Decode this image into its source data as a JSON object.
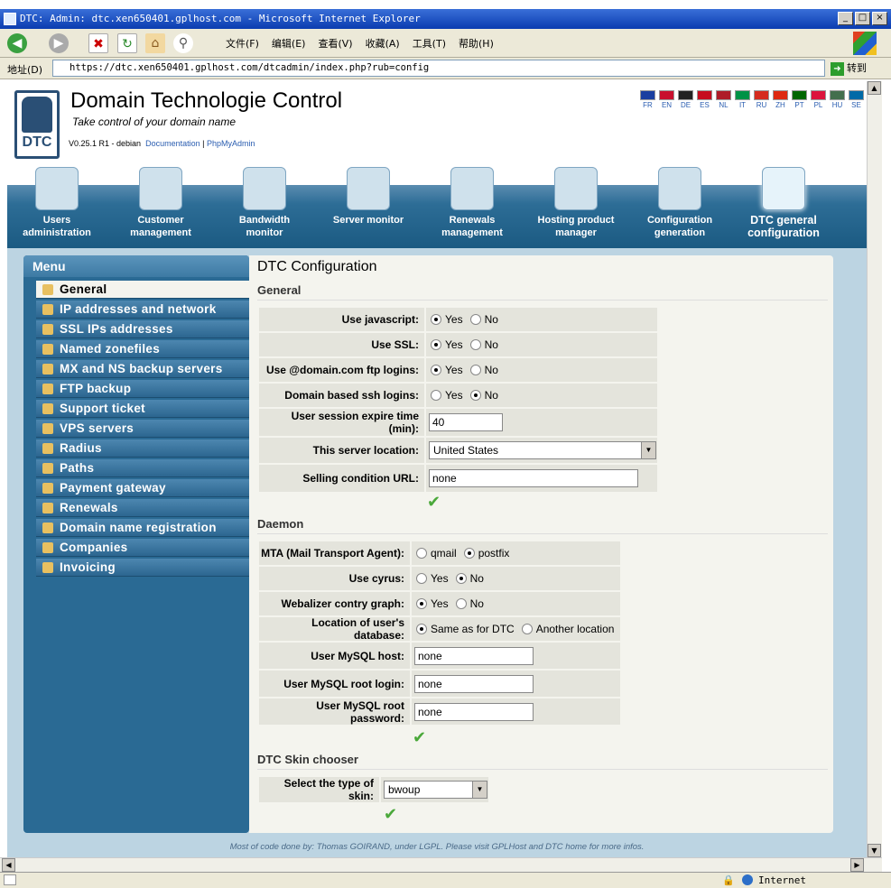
{
  "window": {
    "title": "DTC: Admin: dtc.xen650401.gplhost.com - Microsoft Internet Explorer",
    "min": "_",
    "max": "□",
    "close": "×"
  },
  "browser_menu": [
    "文件(F)",
    "编辑(E)",
    "查看(V)",
    "收藏(A)",
    "工具(T)",
    "帮助(H)"
  ],
  "address": {
    "label": "地址(D)",
    "url": "https://dtc.xen650401.gplhost.com/dtcadmin/index.php?rub=config",
    "go": "转到"
  },
  "app": {
    "title": "Domain Technologie Control",
    "subtitle": "Take control of your domain name",
    "version": "V0.25.1 R1 - debian",
    "doc_link": "Documentation",
    "sep": "|",
    "pma_link": "PhpMyAdmin",
    "logo_text": "DTC"
  },
  "languages": [
    "FR",
    "EN",
    "DE",
    "ES",
    "NL",
    "IT",
    "RU",
    "ZH",
    "PT",
    "PL",
    "HU",
    "SE"
  ],
  "nav": [
    {
      "l1": "Users",
      "l2": "administration"
    },
    {
      "l1": "Customer",
      "l2": "management"
    },
    {
      "l1": "Bandwidth",
      "l2": "monitor"
    },
    {
      "l1": "Server monitor",
      "l2": ""
    },
    {
      "l1": "Renewals",
      "l2": "management"
    },
    {
      "l1": "Hosting product",
      "l2": "manager"
    },
    {
      "l1": "Configuration",
      "l2": "generation"
    },
    {
      "l1": "DTC general",
      "l2": "configuration"
    }
  ],
  "menu": {
    "title": "Menu",
    "items": [
      "General",
      "IP addresses and network",
      "SSL IPs addresses",
      "Named zonefiles",
      "MX and NS backup servers",
      "FTP backup",
      "Support ticket",
      "VPS servers",
      "Radius",
      "Paths",
      "Payment gateway",
      "Renewals",
      "Domain name registration",
      "Companies",
      "Invoicing"
    ]
  },
  "content": {
    "title": "DTC Configuration",
    "general": {
      "heading": "General",
      "yes": "Yes",
      "no": "No",
      "use_js": "Use javascript:",
      "use_ssl": "Use SSL:",
      "use_ftp": "Use @domain.com ftp logins:",
      "ssh": "Domain based ssh logins:",
      "expire": "User session expire time (min):",
      "expire_val": "40",
      "location": "This server location:",
      "location_val": "United States",
      "selling": "Selling condition URL:",
      "selling_val": "none"
    },
    "daemon": {
      "heading": "Daemon",
      "mta": "MTA (Mail Transport Agent):",
      "qmail": "qmail",
      "postfix": "postfix",
      "cyrus": "Use cyrus:",
      "webalizer": "Webalizer contry graph:",
      "dbloc": "Location of user's database:",
      "same": "Same as for DTC",
      "another": "Another location",
      "host": "User MySQL host:",
      "host_val": "none",
      "rootlogin": "User MySQL root login:",
      "rootlogin_val": "none",
      "rootpass": "User MySQL root password:",
      "rootpass_val": "none",
      "yes": "Yes",
      "no": "No"
    },
    "skin": {
      "heading": "DTC Skin chooser",
      "label": "Select the type of skin:",
      "value": "bwoup"
    }
  },
  "footer": "Most of code done by: Thomas GOIRAND, under LGPL. Please visit GPLHost and DTC home for more infos.",
  "status": {
    "zone": "Internet"
  }
}
